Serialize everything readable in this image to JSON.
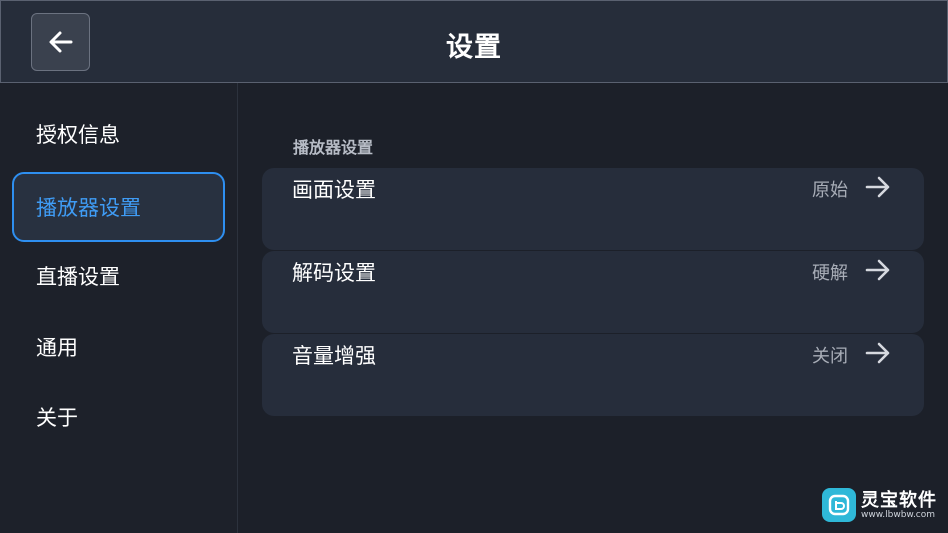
{
  "header": {
    "title": "设置",
    "back_icon": "arrow-left-icon"
  },
  "sidebar": {
    "items": [
      {
        "label": "授权信息",
        "active": false
      },
      {
        "label": "播放器设置",
        "active": true
      },
      {
        "label": "直播设置",
        "active": false
      },
      {
        "label": "通用",
        "active": false
      },
      {
        "label": "关于",
        "active": false
      }
    ]
  },
  "main": {
    "section_title": "播放器设置",
    "rows": [
      {
        "label": "画面设置",
        "value": "原始",
        "icon": "arrow-right-icon"
      },
      {
        "label": "解码设置",
        "value": "硬解",
        "icon": "arrow-right-icon"
      },
      {
        "label": "音量增强",
        "value": "关闭",
        "icon": "arrow-right-icon"
      }
    ]
  },
  "watermark": {
    "name": "灵宝软件",
    "url": "www.lbwbw.com"
  },
  "colors": {
    "accent": "#2e8ff0",
    "background": "#1c2029",
    "header": "#262d3a",
    "row": "#262d3b"
  }
}
